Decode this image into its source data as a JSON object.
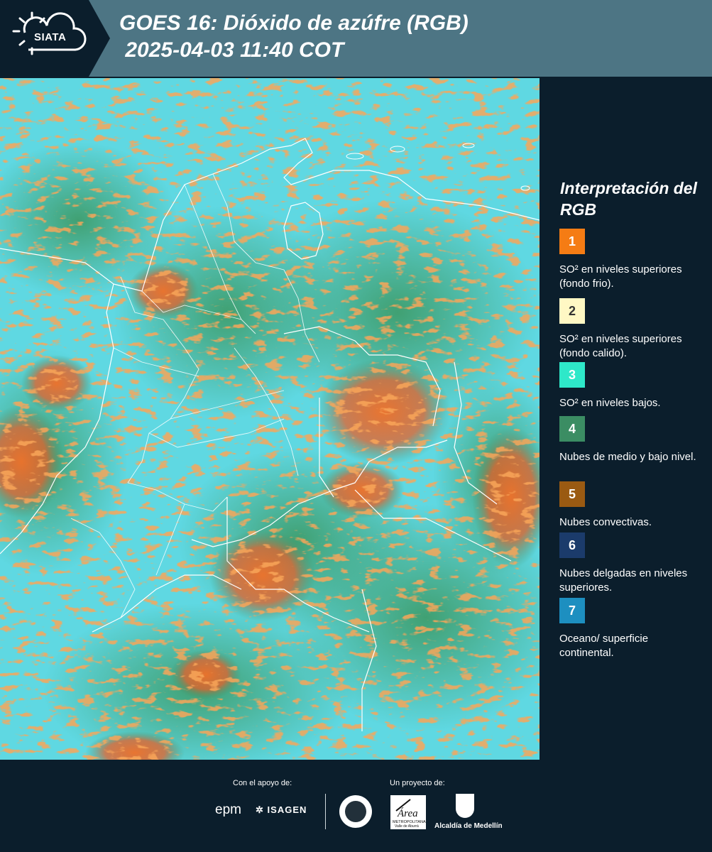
{
  "header": {
    "logo_text": "SIATA",
    "title_line1": "GOES 16: Dióxido de azúfre (RGB)",
    "title_line2": " 2025-04-03 11:40 COT"
  },
  "legend": {
    "title": "Interpretación del RGB",
    "items": [
      {
        "number": "1",
        "color": "#f57c14",
        "text": "SO² en niveles superiores (fondo frio)."
      },
      {
        "number": "2",
        "color": "#fff8c4",
        "text": "SO² en niveles superiores (fondo calido)."
      },
      {
        "number": "3",
        "color": "#2ee8c9",
        "text": "SO² en niveles bajos."
      },
      {
        "number": "4",
        "color": "#3b8d63",
        "text": "Nubes de medio y bajo nivel."
      },
      {
        "number": "5",
        "color": "#9a5a12",
        "text": "Nubes convectivas."
      },
      {
        "number": "6",
        "color": "#1b3b6b",
        "text": "Nubes delgadas en niveles superiores."
      },
      {
        "number": "7",
        "color": "#1d8fc0",
        "text": "Oceano/ superficie continental."
      }
    ]
  },
  "footer": {
    "support_label": "Con el apoyo de:",
    "project_label": "Un proyecto de:",
    "epm_text": "epm",
    "isagen_text": "ISAGEN",
    "area_text": "Área",
    "area_sub": "METROPOLITANA",
    "area_sub2": "Valle de Aburrá",
    "alcaldia_text": "Alcaldía de Medellín"
  },
  "colors": {
    "header_bg": "#4d7584",
    "panel_bg": "#0b1e2c",
    "map_cyan": "#59d9e3",
    "map_green": "#3b8d63",
    "map_orange": "#f2661e"
  }
}
